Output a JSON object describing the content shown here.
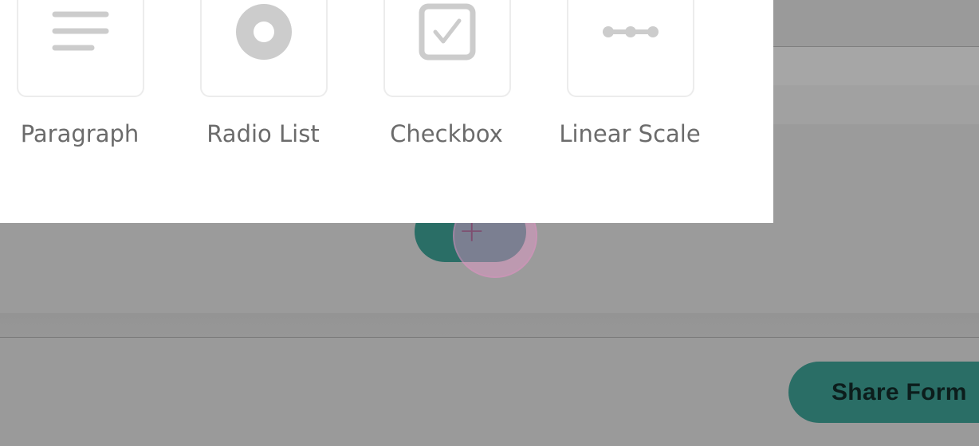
{
  "question_types": [
    {
      "label": "Paragraph",
      "icon": "paragraph-icon"
    },
    {
      "label": "Radio List",
      "icon": "radio-icon"
    },
    {
      "label": "Checkbox",
      "icon": "checkbox-icon"
    },
    {
      "label": "Linear Scale",
      "icon": "linear-scale-icon"
    }
  ],
  "add_button": {
    "label": "+",
    "icon": "plus-icon"
  },
  "share_button": {
    "label": "Share Form"
  },
  "colors": {
    "accent": "#2a6e66",
    "scrim_background": "#9b9b9b",
    "icon_gray": "#cccccc",
    "label_gray": "#6b6b6b",
    "ripple": "#ec96cd"
  }
}
